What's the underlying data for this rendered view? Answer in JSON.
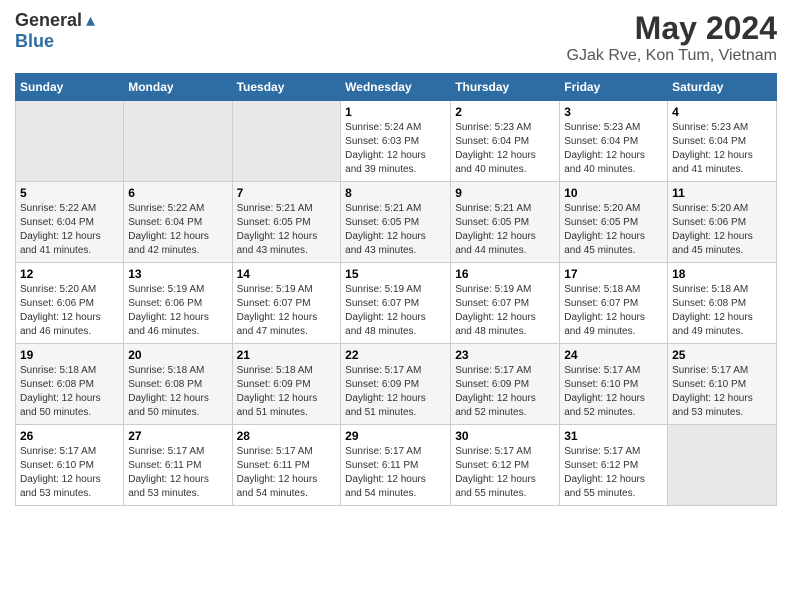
{
  "header": {
    "logo_general": "General",
    "logo_blue": "Blue",
    "title": "May 2024",
    "subtitle": "GJak Rve, Kon Tum, Vietnam"
  },
  "columns": [
    "Sunday",
    "Monday",
    "Tuesday",
    "Wednesday",
    "Thursday",
    "Friday",
    "Saturday"
  ],
  "weeks": [
    [
      {
        "day": "",
        "info": ""
      },
      {
        "day": "",
        "info": ""
      },
      {
        "day": "",
        "info": ""
      },
      {
        "day": "1",
        "info": "Sunrise: 5:24 AM\nSunset: 6:03 PM\nDaylight: 12 hours\nand 39 minutes."
      },
      {
        "day": "2",
        "info": "Sunrise: 5:23 AM\nSunset: 6:04 PM\nDaylight: 12 hours\nand 40 minutes."
      },
      {
        "day": "3",
        "info": "Sunrise: 5:23 AM\nSunset: 6:04 PM\nDaylight: 12 hours\nand 40 minutes."
      },
      {
        "day": "4",
        "info": "Sunrise: 5:23 AM\nSunset: 6:04 PM\nDaylight: 12 hours\nand 41 minutes."
      }
    ],
    [
      {
        "day": "5",
        "info": "Sunrise: 5:22 AM\nSunset: 6:04 PM\nDaylight: 12 hours\nand 41 minutes."
      },
      {
        "day": "6",
        "info": "Sunrise: 5:22 AM\nSunset: 6:04 PM\nDaylight: 12 hours\nand 42 minutes."
      },
      {
        "day": "7",
        "info": "Sunrise: 5:21 AM\nSunset: 6:05 PM\nDaylight: 12 hours\nand 43 minutes."
      },
      {
        "day": "8",
        "info": "Sunrise: 5:21 AM\nSunset: 6:05 PM\nDaylight: 12 hours\nand 43 minutes."
      },
      {
        "day": "9",
        "info": "Sunrise: 5:21 AM\nSunset: 6:05 PM\nDaylight: 12 hours\nand 44 minutes."
      },
      {
        "day": "10",
        "info": "Sunrise: 5:20 AM\nSunset: 6:05 PM\nDaylight: 12 hours\nand 45 minutes."
      },
      {
        "day": "11",
        "info": "Sunrise: 5:20 AM\nSunset: 6:06 PM\nDaylight: 12 hours\nand 45 minutes."
      }
    ],
    [
      {
        "day": "12",
        "info": "Sunrise: 5:20 AM\nSunset: 6:06 PM\nDaylight: 12 hours\nand 46 minutes."
      },
      {
        "day": "13",
        "info": "Sunrise: 5:19 AM\nSunset: 6:06 PM\nDaylight: 12 hours\nand 46 minutes."
      },
      {
        "day": "14",
        "info": "Sunrise: 5:19 AM\nSunset: 6:07 PM\nDaylight: 12 hours\nand 47 minutes."
      },
      {
        "day": "15",
        "info": "Sunrise: 5:19 AM\nSunset: 6:07 PM\nDaylight: 12 hours\nand 48 minutes."
      },
      {
        "day": "16",
        "info": "Sunrise: 5:19 AM\nSunset: 6:07 PM\nDaylight: 12 hours\nand 48 minutes."
      },
      {
        "day": "17",
        "info": "Sunrise: 5:18 AM\nSunset: 6:07 PM\nDaylight: 12 hours\nand 49 minutes."
      },
      {
        "day": "18",
        "info": "Sunrise: 5:18 AM\nSunset: 6:08 PM\nDaylight: 12 hours\nand 49 minutes."
      }
    ],
    [
      {
        "day": "19",
        "info": "Sunrise: 5:18 AM\nSunset: 6:08 PM\nDaylight: 12 hours\nand 50 minutes."
      },
      {
        "day": "20",
        "info": "Sunrise: 5:18 AM\nSunset: 6:08 PM\nDaylight: 12 hours\nand 50 minutes."
      },
      {
        "day": "21",
        "info": "Sunrise: 5:18 AM\nSunset: 6:09 PM\nDaylight: 12 hours\nand 51 minutes."
      },
      {
        "day": "22",
        "info": "Sunrise: 5:17 AM\nSunset: 6:09 PM\nDaylight: 12 hours\nand 51 minutes."
      },
      {
        "day": "23",
        "info": "Sunrise: 5:17 AM\nSunset: 6:09 PM\nDaylight: 12 hours\nand 52 minutes."
      },
      {
        "day": "24",
        "info": "Sunrise: 5:17 AM\nSunset: 6:10 PM\nDaylight: 12 hours\nand 52 minutes."
      },
      {
        "day": "25",
        "info": "Sunrise: 5:17 AM\nSunset: 6:10 PM\nDaylight: 12 hours\nand 53 minutes."
      }
    ],
    [
      {
        "day": "26",
        "info": "Sunrise: 5:17 AM\nSunset: 6:10 PM\nDaylight: 12 hours\nand 53 minutes."
      },
      {
        "day": "27",
        "info": "Sunrise: 5:17 AM\nSunset: 6:11 PM\nDaylight: 12 hours\nand 53 minutes."
      },
      {
        "day": "28",
        "info": "Sunrise: 5:17 AM\nSunset: 6:11 PM\nDaylight: 12 hours\nand 54 minutes."
      },
      {
        "day": "29",
        "info": "Sunrise: 5:17 AM\nSunset: 6:11 PM\nDaylight: 12 hours\nand 54 minutes."
      },
      {
        "day": "30",
        "info": "Sunrise: 5:17 AM\nSunset: 6:12 PM\nDaylight: 12 hours\nand 55 minutes."
      },
      {
        "day": "31",
        "info": "Sunrise: 5:17 AM\nSunset: 6:12 PM\nDaylight: 12 hours\nand 55 minutes."
      },
      {
        "day": "",
        "info": ""
      }
    ]
  ]
}
